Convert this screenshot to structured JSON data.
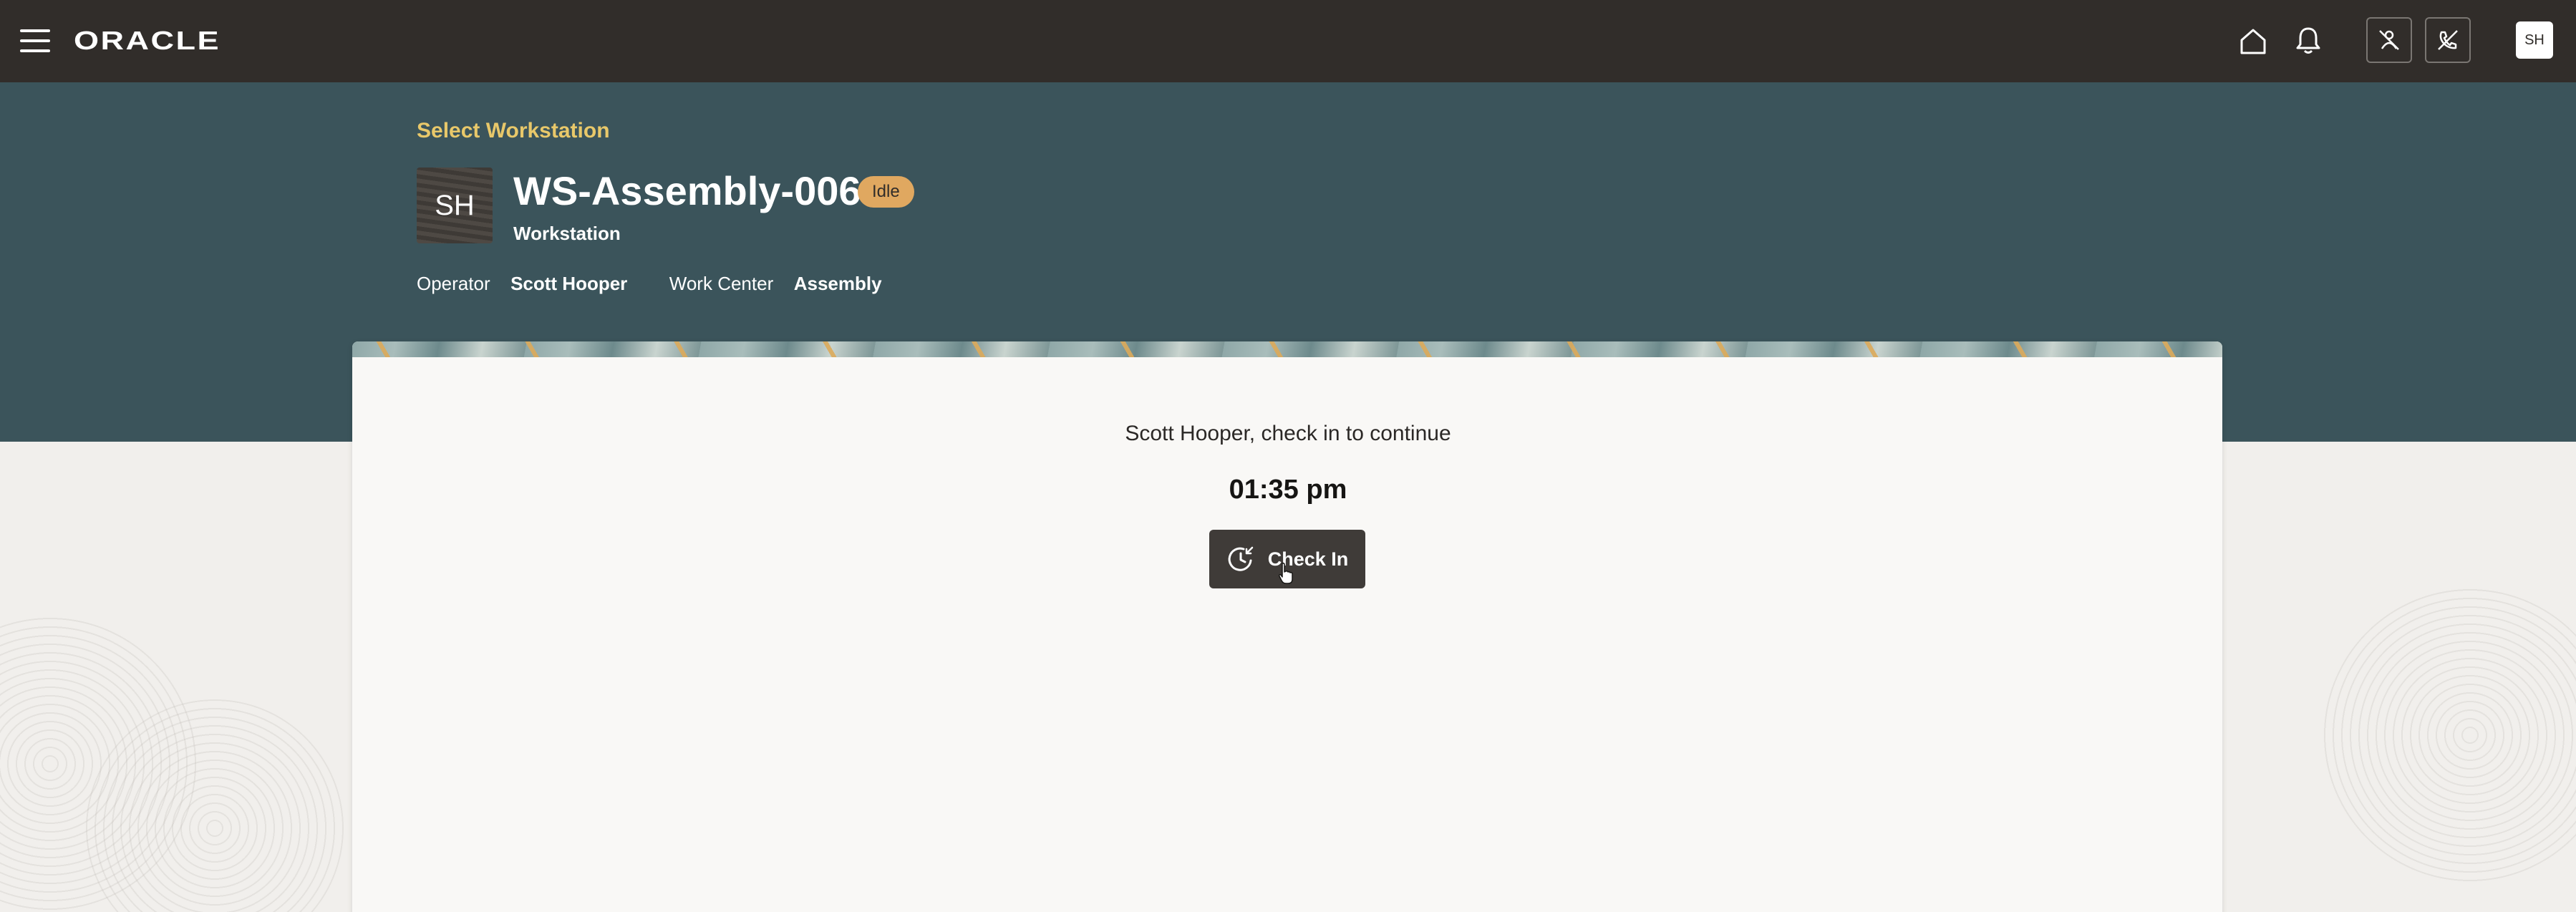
{
  "topbar": {
    "brand": "ORACLE",
    "user_initials": "SH",
    "icons": [
      "menu-icon",
      "home-icon",
      "bell-icon",
      "person-off-icon",
      "phone-off-icon"
    ]
  },
  "header": {
    "breadcrumb": "Select Workstation",
    "avatar_initials": "SH",
    "title": "WS-Assembly-006",
    "status": "Idle",
    "subtitle": "Workstation",
    "operator_label": "Operator",
    "operator_value": "Scott Hooper",
    "work_center_label": "Work Center",
    "work_center_value": "Assembly"
  },
  "card": {
    "prompt": "Scott Hooper, check in to continue",
    "time": "01:35 pm",
    "check_in_label": "Check In"
  },
  "colors": {
    "topbar": "#312d2a",
    "header_band": "#3b545b",
    "breadcrumb": "#e8c86a",
    "status_badge": "#e0a860",
    "button": "#3f3b38",
    "page_bg": "#f1efec"
  }
}
